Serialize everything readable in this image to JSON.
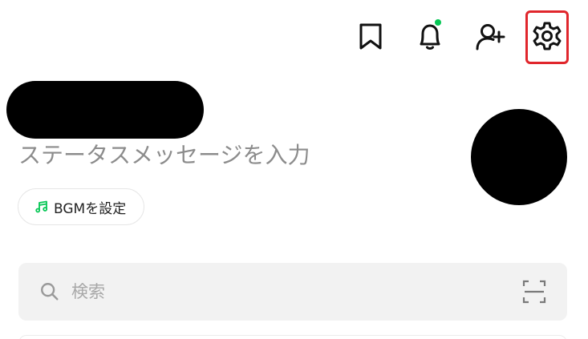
{
  "header": {
    "icons": [
      {
        "name": "bookmark-icon"
      },
      {
        "name": "bell-icon",
        "has_notification_dot": true
      },
      {
        "name": "add-friend-icon"
      },
      {
        "name": "gear-icon",
        "highlighted": true
      }
    ]
  },
  "profile": {
    "status_message": "ステータスメッセージを入力",
    "bgm_button_label": "BGMを設定",
    "bgm_icon": "music-note-icon"
  },
  "search": {
    "placeholder": "検索",
    "value": "",
    "scan_icon": "qr-scan-icon"
  },
  "colors": {
    "notification_dot": "#06c755",
    "highlight_border": "#e0262c",
    "music_icon": "#06c755",
    "search_bg": "#f2f2f2",
    "placeholder": "#a8a8a8",
    "status_text": "#8c8c8c"
  }
}
